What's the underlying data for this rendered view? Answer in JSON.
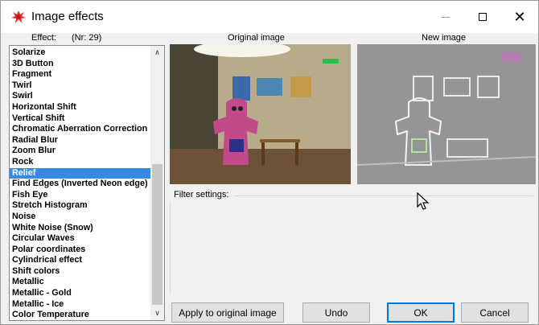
{
  "window": {
    "title": "Image effects",
    "icon": "red-splat-icon",
    "controls": [
      "minimize-icon",
      "maximize-icon",
      "close-icon"
    ],
    "close_glyph": "✕"
  },
  "headers": {
    "effect_label": "Effect:",
    "effect_count": "(Nr: 29)",
    "original_image": "Original image",
    "new_image": "New image"
  },
  "effects_list": {
    "items": [
      "Solarize",
      "3D Button",
      "Fragment",
      "Twirl",
      "Swirl",
      "Horizontal Shift",
      "Vertical Shift",
      "Chromatic Aberration Correction",
      "Radial Blur",
      "Zoom Blur",
      "Rock",
      "Relief",
      "Find Edges (Inverted Neon edge)",
      "Fish Eye",
      "Stretch Histogram",
      "Noise",
      "White Noise (Snow)",
      "Circular Waves",
      "Polar coordinates",
      "Cylindrical effect",
      "Shift colors",
      "Metallic",
      "Metallic - Gold",
      "Metallic - Ice",
      "Color Temperature"
    ],
    "selected": "Relief",
    "selected_index": 11,
    "scroll_up_glyph": "∧",
    "scroll_down_glyph": "∨"
  },
  "filter_settings": {
    "label": "Filter settings:"
  },
  "buttons": {
    "apply": "Apply to original image",
    "undo": "Undo",
    "ok": "OK",
    "cancel": "Cancel"
  },
  "colors": {
    "selection": "#3a89e0",
    "ok_border": "#0078d7",
    "window_bg": "#f0f0f0"
  }
}
